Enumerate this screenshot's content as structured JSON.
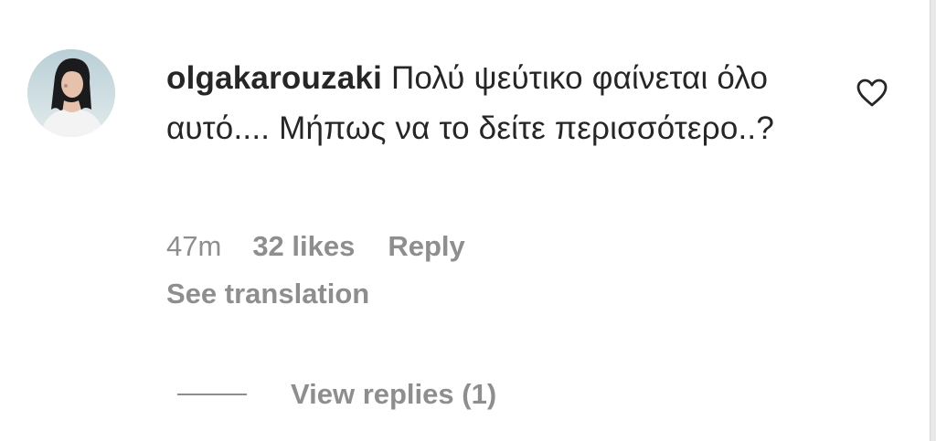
{
  "comment": {
    "avatar": "user-avatar",
    "username": "olgakarouzaki",
    "text": "Πολύ ψεύτικο φαίνεται όλο αυτό.... Μήπως να το δείτε περισσότερο..?",
    "like_icon": "heart-outline-icon"
  },
  "meta": {
    "age": "47m",
    "likes": "32 likes",
    "reply": "Reply",
    "see_translation": "See translation"
  },
  "replies": {
    "view_label": "View replies (1)"
  },
  "colors": {
    "primary_text": "#262626",
    "secondary_text": "#8e8e8e"
  }
}
